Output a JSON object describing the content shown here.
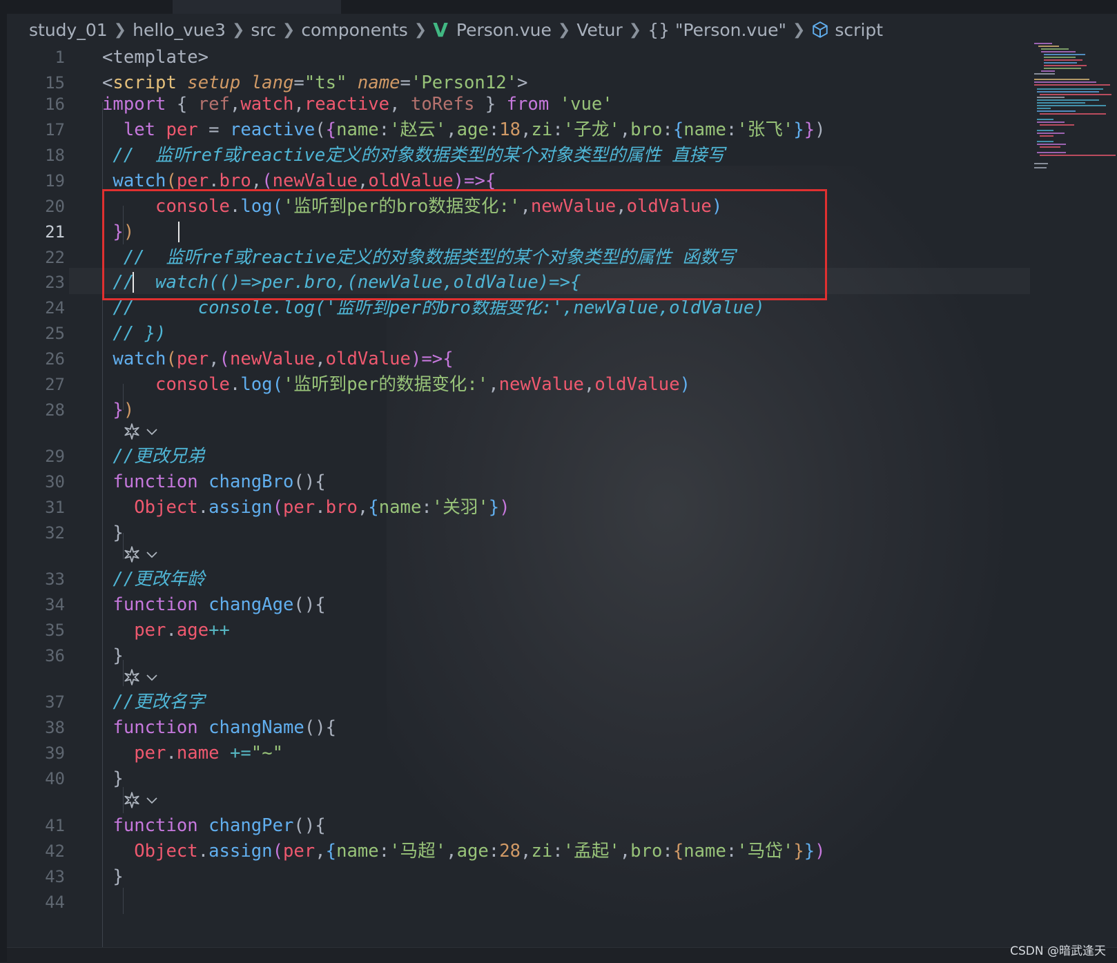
{
  "breadcrumb": {
    "items": [
      "study_01",
      "hello_vue3",
      "src",
      "components",
      "Person.vue",
      "Vetur",
      "{} \"Person.vue\"",
      "script"
    ],
    "icons": {
      "vue": "vue-logo-icon",
      "script": "cube-icon"
    }
  },
  "editor": {
    "current_line": "21",
    "codelens_label": "codelens-icon",
    "lines": [
      {
        "n": "1",
        "code": [
          [
            "<template>",
            "#abb2bf"
          ]
        ]
      },
      {
        "n": "15",
        "code": [
          [
            "<",
            "#abb2bf"
          ],
          [
            "script",
            "#e5c07b"
          ],
          [
            " ",
            "#abb2bf"
          ],
          [
            "setup",
            "#d19a66",
            "i"
          ],
          [
            " ",
            "#abb2bf"
          ],
          [
            "lang",
            "#d19a66",
            "i"
          ],
          [
            "=",
            "#abb2bf"
          ],
          [
            "\"ts\"",
            "#98c379"
          ],
          [
            " ",
            "#abb2bf"
          ],
          [
            "name",
            "#d19a66",
            "i"
          ],
          [
            "=",
            "#abb2bf"
          ],
          [
            "'Person12'",
            "#98c379"
          ],
          [
            ">",
            "#abb2bf"
          ]
        ]
      },
      {
        "n": "16",
        "code": [
          [
            "import",
            "#c678dd"
          ],
          [
            " { ",
            "#abb2bf"
          ],
          [
            "ref",
            "#b5726e"
          ],
          [
            ",",
            "#abb2bf"
          ],
          [
            "watch",
            "#ef596f"
          ],
          [
            ",",
            "#abb2bf"
          ],
          [
            "reactive",
            "#ef596f"
          ],
          [
            ", ",
            "#abb2bf"
          ],
          [
            "toRefs",
            "#b5726e"
          ],
          [
            " } ",
            "#abb2bf"
          ],
          [
            "from",
            "#c678dd"
          ],
          [
            " ",
            "#abb2bf"
          ],
          [
            "'vue'",
            "#98c379"
          ]
        ]
      },
      {
        "n": "17",
        "code": [
          [
            "  ",
            "#abb2bf"
          ],
          [
            "let",
            "#c678dd"
          ],
          [
            " ",
            "#abb2bf"
          ],
          [
            "per",
            "#ef596f"
          ],
          [
            " = ",
            "#abb2bf"
          ],
          [
            "reactive",
            "#61afef"
          ],
          [
            "(",
            "#abb2bf"
          ],
          [
            "{",
            "#c678dd"
          ],
          [
            "name",
            "#98c379"
          ],
          [
            ":",
            "#abb2bf"
          ],
          [
            "'赵云'",
            "#98c379"
          ],
          [
            ",",
            "#abb2bf"
          ],
          [
            "age",
            "#98c379"
          ],
          [
            ":",
            "#abb2bf"
          ],
          [
            "18",
            "#d19a66"
          ],
          [
            ",",
            "#abb2bf"
          ],
          [
            "zi",
            "#98c379"
          ],
          [
            ":",
            "#abb2bf"
          ],
          [
            "'子龙'",
            "#98c379"
          ],
          [
            ",",
            "#abb2bf"
          ],
          [
            "bro",
            "#98c379"
          ],
          [
            ":",
            "#abb2bf"
          ],
          [
            "{",
            "#61afef"
          ],
          [
            "name",
            "#98c379"
          ],
          [
            ":",
            "#abb2bf"
          ],
          [
            "'张飞'",
            "#98c379"
          ],
          [
            "}",
            "#61afef"
          ],
          [
            "}",
            "#c678dd"
          ],
          [
            ")",
            "#abb2bf"
          ]
        ]
      },
      {
        "n": "18",
        "code": [
          [
            " ",
            "#abb2bf"
          ],
          [
            "//  监听ref或reactive定义的对象数据类型的某个对象类型的属性 直接写",
            "#4fb6d6",
            "i"
          ]
        ]
      },
      {
        "n": "19",
        "code": [
          [
            " ",
            "#abb2bf"
          ],
          [
            "watch",
            "#61afef"
          ],
          [
            "(",
            "#d19a66"
          ],
          [
            "per",
            "#ef596f"
          ],
          [
            ".",
            "#abb2bf"
          ],
          [
            "bro",
            "#ef596f"
          ],
          [
            ",",
            "#abb2bf"
          ],
          [
            "(",
            "#c678dd"
          ],
          [
            "newValue",
            "#ef596f"
          ],
          [
            ",",
            "#abb2bf"
          ],
          [
            "oldValue",
            "#ef596f"
          ],
          [
            ")",
            "#c678dd"
          ],
          [
            "=>",
            "#c678dd"
          ],
          [
            "{",
            "#c678dd"
          ]
        ]
      },
      {
        "n": "20",
        "code": [
          [
            "     ",
            "#abb2bf"
          ],
          [
            "console",
            "#ef596f"
          ],
          [
            ".",
            "#abb2bf"
          ],
          [
            "log",
            "#61afef"
          ],
          [
            "(",
            "#61afef"
          ],
          [
            "'监听到per的bro数据变化:'",
            "#98c379"
          ],
          [
            ",",
            "#abb2bf"
          ],
          [
            "newValue",
            "#ef596f"
          ],
          [
            ",",
            "#abb2bf"
          ],
          [
            "oldValue",
            "#ef596f"
          ],
          [
            ")",
            "#61afef"
          ]
        ]
      },
      {
        "n": "21",
        "code": [
          [
            " ",
            "#abb2bf"
          ],
          [
            "}",
            "#c678dd"
          ],
          [
            ")",
            "#d19a66"
          ]
        ]
      },
      {
        "n": "22",
        "code": [
          [
            "  ",
            "#abb2bf"
          ],
          [
            "//  监听ref或reactive定义的对象数据类型的某个对象类型的属性 函数写",
            "#4fb6d6",
            "i"
          ]
        ]
      },
      {
        "n": "23",
        "code": [
          [
            " ",
            "#abb2bf"
          ],
          [
            "//  watch(()=>per.bro,(newValue,oldValue)=>{",
            "#4fb6d6",
            "i"
          ]
        ]
      },
      {
        "n": "24",
        "code": [
          [
            " ",
            "#abb2bf"
          ],
          [
            "//      console.log('监听到per的bro数据变化:',newValue,oldValue)",
            "#4fb6d6",
            "i"
          ]
        ]
      },
      {
        "n": "25",
        "code": [
          [
            " ",
            "#abb2bf"
          ],
          [
            "// })",
            "#4fb6d6",
            "i"
          ]
        ]
      },
      {
        "n": "26",
        "code": [
          [
            " ",
            "#abb2bf"
          ],
          [
            "watch",
            "#61afef"
          ],
          [
            "(",
            "#d19a66"
          ],
          [
            "per",
            "#ef596f"
          ],
          [
            ",",
            "#abb2bf"
          ],
          [
            "(",
            "#c678dd"
          ],
          [
            "newValue",
            "#ef596f"
          ],
          [
            ",",
            "#abb2bf"
          ],
          [
            "oldValue",
            "#ef596f"
          ],
          [
            ")",
            "#c678dd"
          ],
          [
            "=>",
            "#c678dd"
          ],
          [
            "{",
            "#c678dd"
          ]
        ]
      },
      {
        "n": "27",
        "code": [
          [
            "     ",
            "#abb2bf"
          ],
          [
            "console",
            "#ef596f"
          ],
          [
            ".",
            "#abb2bf"
          ],
          [
            "log",
            "#61afef"
          ],
          [
            "(",
            "#61afef"
          ],
          [
            "'监听到per的数据变化:'",
            "#98c379"
          ],
          [
            ",",
            "#abb2bf"
          ],
          [
            "newValue",
            "#ef596f"
          ],
          [
            ",",
            "#abb2bf"
          ],
          [
            "oldValue",
            "#ef596f"
          ],
          [
            ")",
            "#61afef"
          ]
        ]
      },
      {
        "n": "28",
        "code": [
          [
            " ",
            "#abb2bf"
          ],
          [
            "}",
            "#c678dd"
          ],
          [
            ")",
            "#d19a66"
          ]
        ]
      },
      {
        "n": "29",
        "code": [
          [
            " ",
            "#abb2bf"
          ],
          [
            "//更改兄弟",
            "#4fb6d6",
            "i"
          ]
        ]
      },
      {
        "n": "30",
        "code": [
          [
            " ",
            "#abb2bf"
          ],
          [
            "function",
            "#c678dd"
          ],
          [
            " ",
            "#abb2bf"
          ],
          [
            "changBro",
            "#61afef"
          ],
          [
            "(){",
            "#abb2bf"
          ]
        ]
      },
      {
        "n": "31",
        "code": [
          [
            "   ",
            "#abb2bf"
          ],
          [
            "Object",
            "#ef596f"
          ],
          [
            ".",
            "#abb2bf"
          ],
          [
            "assign",
            "#61afef"
          ],
          [
            "(",
            "#c678dd"
          ],
          [
            "per",
            "#ef596f"
          ],
          [
            ".",
            "#abb2bf"
          ],
          [
            "bro",
            "#ef596f"
          ],
          [
            ",",
            "#abb2bf"
          ],
          [
            "{",
            "#61afef"
          ],
          [
            "name",
            "#98c379"
          ],
          [
            ":",
            "#abb2bf"
          ],
          [
            "'关羽'",
            "#98c379"
          ],
          [
            "}",
            "#61afef"
          ],
          [
            ")",
            "#c678dd"
          ]
        ]
      },
      {
        "n": "32",
        "code": [
          [
            " }",
            "#abb2bf"
          ]
        ]
      },
      {
        "n": "33",
        "code": [
          [
            " ",
            "#abb2bf"
          ],
          [
            "//更改年龄",
            "#4fb6d6",
            "i"
          ]
        ]
      },
      {
        "n": "34",
        "code": [
          [
            " ",
            "#abb2bf"
          ],
          [
            "function",
            "#c678dd"
          ],
          [
            " ",
            "#abb2bf"
          ],
          [
            "changAge",
            "#61afef"
          ],
          [
            "(){",
            "#abb2bf"
          ]
        ]
      },
      {
        "n": "35",
        "code": [
          [
            "   ",
            "#abb2bf"
          ],
          [
            "per",
            "#ef596f"
          ],
          [
            ".",
            "#abb2bf"
          ],
          [
            "age",
            "#ef596f"
          ],
          [
            "++",
            "#56b6c2"
          ]
        ]
      },
      {
        "n": "36",
        "code": [
          [
            " }",
            "#abb2bf"
          ]
        ]
      },
      {
        "n": "37",
        "code": [
          [
            " ",
            "#abb2bf"
          ],
          [
            "//更改名字",
            "#4fb6d6",
            "i"
          ]
        ]
      },
      {
        "n": "38",
        "code": [
          [
            " ",
            "#abb2bf"
          ],
          [
            "function",
            "#c678dd"
          ],
          [
            " ",
            "#abb2bf"
          ],
          [
            "changName",
            "#61afef"
          ],
          [
            "(){",
            "#abb2bf"
          ]
        ]
      },
      {
        "n": "39",
        "code": [
          [
            "   ",
            "#abb2bf"
          ],
          [
            "per",
            "#ef596f"
          ],
          [
            ".",
            "#abb2bf"
          ],
          [
            "name",
            "#ef596f"
          ],
          [
            " ",
            "#abb2bf"
          ],
          [
            "+=",
            "#56b6c2"
          ],
          [
            "\"~\"",
            "#98c379"
          ]
        ]
      },
      {
        "n": "40",
        "code": [
          [
            " }",
            "#abb2bf"
          ]
        ]
      },
      {
        "n": "41",
        "code": [
          [
            " ",
            "#abb2bf"
          ],
          [
            "function",
            "#c678dd"
          ],
          [
            " ",
            "#abb2bf"
          ],
          [
            "changPer",
            "#61afef"
          ],
          [
            "(){",
            "#abb2bf"
          ]
        ]
      },
      {
        "n": "42",
        "code": [
          [
            "   ",
            "#abb2bf"
          ],
          [
            "Object",
            "#ef596f"
          ],
          [
            ".",
            "#abb2bf"
          ],
          [
            "assign",
            "#61afef"
          ],
          [
            "(",
            "#c678dd"
          ],
          [
            "per",
            "#ef596f"
          ],
          [
            ",",
            "#abb2bf"
          ],
          [
            "{",
            "#61afef"
          ],
          [
            "name",
            "#98c379"
          ],
          [
            ":",
            "#abb2bf"
          ],
          [
            "'马超'",
            "#98c379"
          ],
          [
            ",",
            "#abb2bf"
          ],
          [
            "age",
            "#98c379"
          ],
          [
            ":",
            "#abb2bf"
          ],
          [
            "28",
            "#d19a66"
          ],
          [
            ",",
            "#abb2bf"
          ],
          [
            "zi",
            "#98c379"
          ],
          [
            ":",
            "#abb2bf"
          ],
          [
            "'孟起'",
            "#98c379"
          ],
          [
            ",",
            "#abb2bf"
          ],
          [
            "bro",
            "#98c379"
          ],
          [
            ":",
            "#abb2bf"
          ],
          [
            "{",
            "#d19a66"
          ],
          [
            "name",
            "#98c379"
          ],
          [
            ":",
            "#abb2bf"
          ],
          [
            "'马岱'",
            "#98c379"
          ],
          [
            "}",
            "#d19a66"
          ],
          [
            "}",
            "#61afef"
          ],
          [
            ")",
            "#c678dd"
          ]
        ]
      },
      {
        "n": "43",
        "code": [
          [
            " }",
            "#abb2bf"
          ]
        ]
      },
      {
        "n": "44",
        "code": []
      }
    ]
  },
  "colors": {
    "background": "#22262c",
    "highlight_box": "#e03030",
    "line_number": "#5f6771",
    "vue_green": "#41b883"
  },
  "watermark": "CSDN @暗武逢天"
}
